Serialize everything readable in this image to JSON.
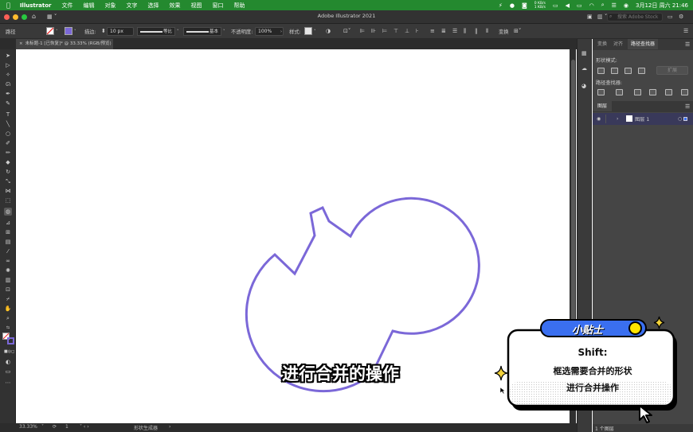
{
  "menubar": {
    "items": [
      "Illustrator",
      "文件",
      "编辑",
      "对象",
      "文字",
      "选择",
      "效果",
      "视图",
      "窗口",
      "帮助"
    ],
    "net_up": "0 KB/s",
    "net_down": "1 KB/s",
    "datetime": "3月12日 周六  21:46"
  },
  "titlebar": {
    "title": "Adobe Illustrator 2021",
    "search_placeholder": "搜索 Adobe Stock"
  },
  "control_bar": {
    "selection_label": "路径",
    "stroke_label": "描边:",
    "stroke_value": "10 px",
    "profile_label": "等比",
    "brush_label": "基本",
    "opacity_label": "不透明度:",
    "opacity_value": "100%",
    "style_label": "样式:",
    "transform_label": "变换"
  },
  "document": {
    "tab_title": "未标题-1 [已恢复]* @ 33.33% (RGB/预览)",
    "zoom": "33.33%",
    "artboard": "1",
    "status_text": "形状生成器"
  },
  "panels": {
    "tabs": [
      "变换",
      "对齐",
      "路径查找器"
    ],
    "shape_modes_label": "形状模式:",
    "expand_label": "扩展",
    "pathfinders_label": "路径查找器:",
    "layers_tab": "图层",
    "layer_name": "图层 1",
    "layers_count": "1 个图层"
  },
  "tip": {
    "badge": "小贴士",
    "line1": "Shift:",
    "line2": "框选需要合并的形状",
    "line3": "进行合并操作"
  },
  "subtitle": "进行合并的操作",
  "colors": {
    "menubar_bg": "#24892f",
    "shape_stroke": "#7b68d8",
    "badge_bg": "#3a6ff0",
    "badge_dot": "#ffe400",
    "sparkle": "#f2d23a"
  }
}
